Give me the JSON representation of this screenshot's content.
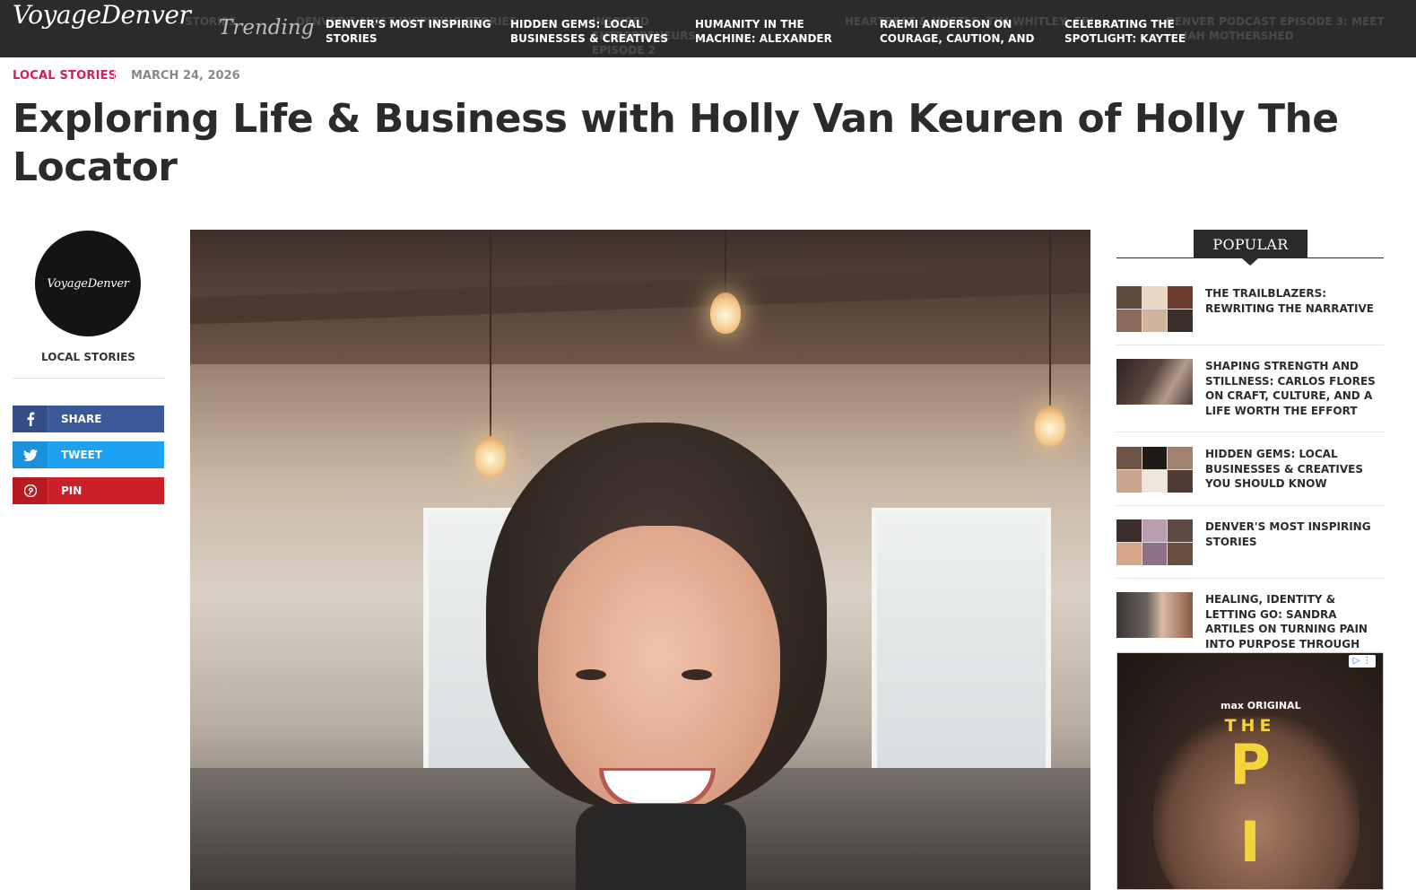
{
  "topbar": {
    "logo": "VoyageDenver",
    "trending_label": "Trending",
    "ghost_items": [
      "STORIES",
      "DENVER'S MOST INSPIRING STORIES",
      "INSPIRED ENTREPRENEURS EPISODE 2",
      "HEARTBEAT & HUSTLE: TIM WHITLEY: EPI",
      "DENVER PODCAST EPISODE 3: MEET",
      "IAH MOTHERSHED"
    ],
    "trending_items": [
      "DENVER'S MOST INSPIRING STORIES",
      "HIDDEN GEMS: LOCAL BUSINESSES & CREATIVES",
      "HUMANITY IN THE MACHINE: ALEXANDER",
      "RAEMI ANDERSON ON COURAGE, CAUTION, AND",
      "CELEBRATING THE SPOTLIGHT: KAYTEE"
    ]
  },
  "article": {
    "category": "LOCAL STORIES",
    "date": "MARCH 24, 2026",
    "title": "Exploring Life & Business with Holly Van Keuren of Holly The Locator"
  },
  "author": {
    "avatar_text": "VoyageDenver",
    "label": "LOCAL STORIES"
  },
  "share": {
    "facebook": {
      "label": "SHARE",
      "icon": "facebook-icon",
      "color": "#3b5998"
    },
    "twitter": {
      "label": "TWEET",
      "icon": "twitter-icon",
      "color": "#1da1f2"
    },
    "pinterest": {
      "label": "PIN",
      "icon": "pinterest-icon",
      "color": "#cb2027"
    }
  },
  "sidebar": {
    "heading": "POPULAR",
    "items": [
      {
        "title": "THE TRAILBLAZERS: REWRITING THE NARRATIVE"
      },
      {
        "title": "SHAPING STRENGTH AND STILLNESS: CARLOS FLORES ON CRAFT, CULTURE, AND A LIFE WORTH THE EFFORT"
      },
      {
        "title": "HIDDEN GEMS: LOCAL BUSINESSES & CREATIVES YOU SHOULD KNOW"
      },
      {
        "title": "DENVER'S MOST INSPIRING STORIES"
      },
      {
        "title": "HEALING, IDENTITY & LETTING GO: SANDRA ARTILES ON TURNING PAIN INTO PURPOSE THROUGH PARA SIEMPRE"
      }
    ]
  },
  "ad": {
    "brand": "max ORIGINAL",
    "line1": "THE",
    "line2": "P",
    "line3": "I",
    "adchoices": "▷ ⋮"
  },
  "colors": {
    "topbar": "#2b2b2b",
    "category": "#d81b60",
    "headline": "#2b2b2b"
  }
}
